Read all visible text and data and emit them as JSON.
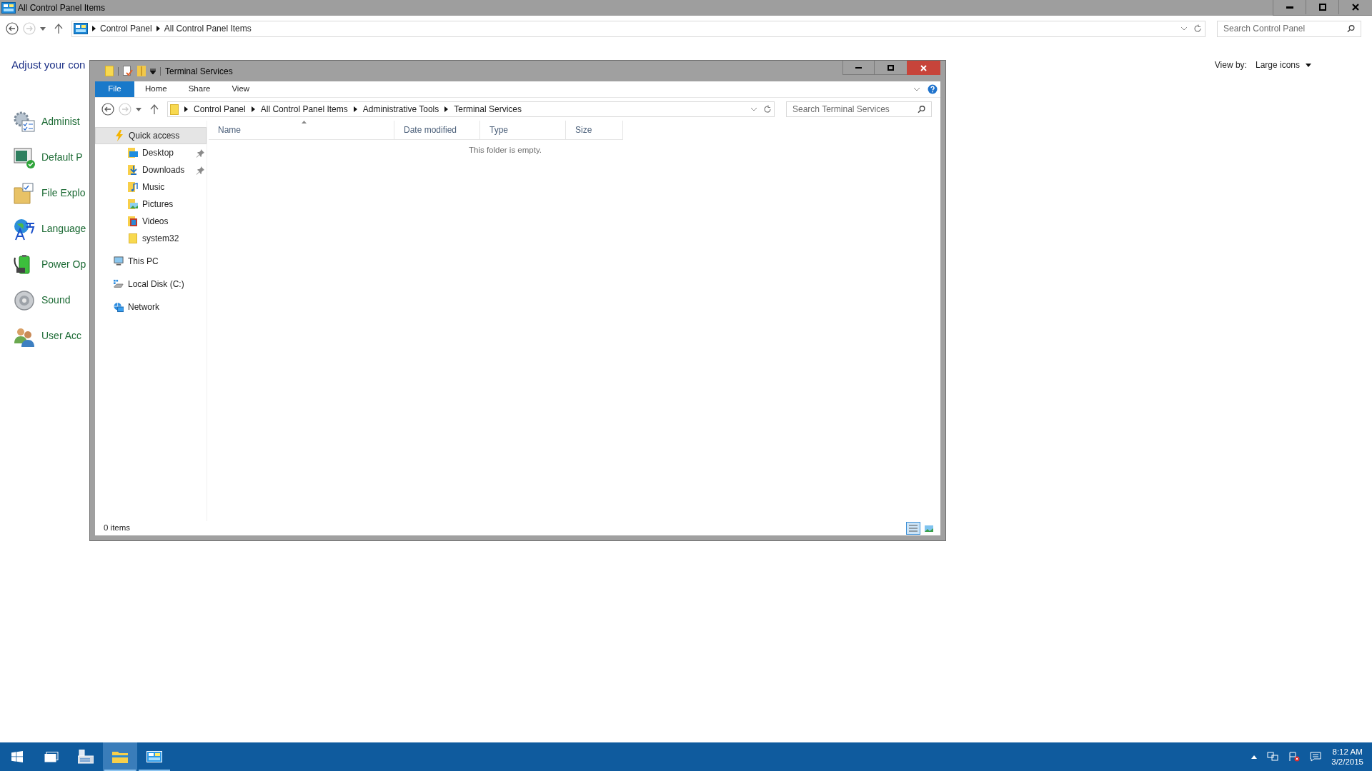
{
  "control_panel": {
    "title": "All Control Panel Items",
    "breadcrumb": [
      "Control Panel",
      "All Control Panel Items"
    ],
    "search": {
      "placeholder": "Search Control Panel"
    },
    "heading": "Adjust your con",
    "view_by": {
      "label": "View by:",
      "value": "Large icons"
    },
    "items": [
      {
        "kind": "admin",
        "label": "Administ"
      },
      {
        "kind": "default",
        "label": "Default P"
      },
      {
        "kind": "folder",
        "label": "File Explo"
      },
      {
        "kind": "language",
        "label": "Language"
      },
      {
        "kind": "power",
        "label": "Power Op"
      },
      {
        "kind": "sound",
        "label": "Sound"
      },
      {
        "kind": "users",
        "label": "User Acc"
      }
    ]
  },
  "explorer": {
    "title": "Terminal Services",
    "ribbon_tabs": [
      {
        "label": "File",
        "selected": true
      },
      {
        "label": "Home",
        "selected": false
      },
      {
        "label": "Share",
        "selected": false
      },
      {
        "label": "View",
        "selected": false
      }
    ],
    "breadcrumb": [
      "Control Panel",
      "All Control Panel Items",
      "Administrative Tools",
      "Terminal Services"
    ],
    "search": {
      "placeholder": "Search Terminal Services"
    },
    "nav": [
      {
        "kind": "quick",
        "label": "Quick access",
        "selected": true,
        "children": [
          {
            "kind": "desktop",
            "label": "Desktop",
            "pinned": true,
            "selected": false
          },
          {
            "kind": "downloads",
            "label": "Downloads",
            "pinned": true,
            "selected": false
          },
          {
            "kind": "music",
            "label": "Music",
            "pinned": false,
            "selected": false
          },
          {
            "kind": "pictures",
            "label": "Pictures",
            "pinned": false,
            "selected": false
          },
          {
            "kind": "videos",
            "label": "Videos",
            "pinned": false,
            "selected": false
          },
          {
            "kind": "folder",
            "label": "system32",
            "pinned": false,
            "selected": false
          }
        ]
      },
      {
        "kind": "pc",
        "label": "This PC",
        "selected": false
      },
      {
        "kind": "disk",
        "label": "Local Disk (C:)",
        "selected": false
      },
      {
        "kind": "network",
        "label": "Network",
        "selected": false
      }
    ],
    "columns": [
      {
        "label": "Name",
        "sorted": true
      },
      {
        "label": "Date modified",
        "sorted": false
      },
      {
        "label": "Type",
        "sorted": false
      },
      {
        "label": "Size",
        "sorted": false
      }
    ],
    "empty_message": "This folder is empty.",
    "status": "0 items"
  },
  "taskbar": {
    "apps": [
      {
        "kind": "start",
        "selected": false,
        "running": false
      },
      {
        "kind": "taskview",
        "selected": false,
        "running": false
      },
      {
        "kind": "server",
        "selected": false,
        "running": false
      },
      {
        "kind": "explorer",
        "selected": true,
        "running": true
      },
      {
        "kind": "controlpanel",
        "selected": false,
        "running": true
      }
    ],
    "clock": {
      "time": "8:12 AM",
      "date": "3/2/2015"
    }
  }
}
